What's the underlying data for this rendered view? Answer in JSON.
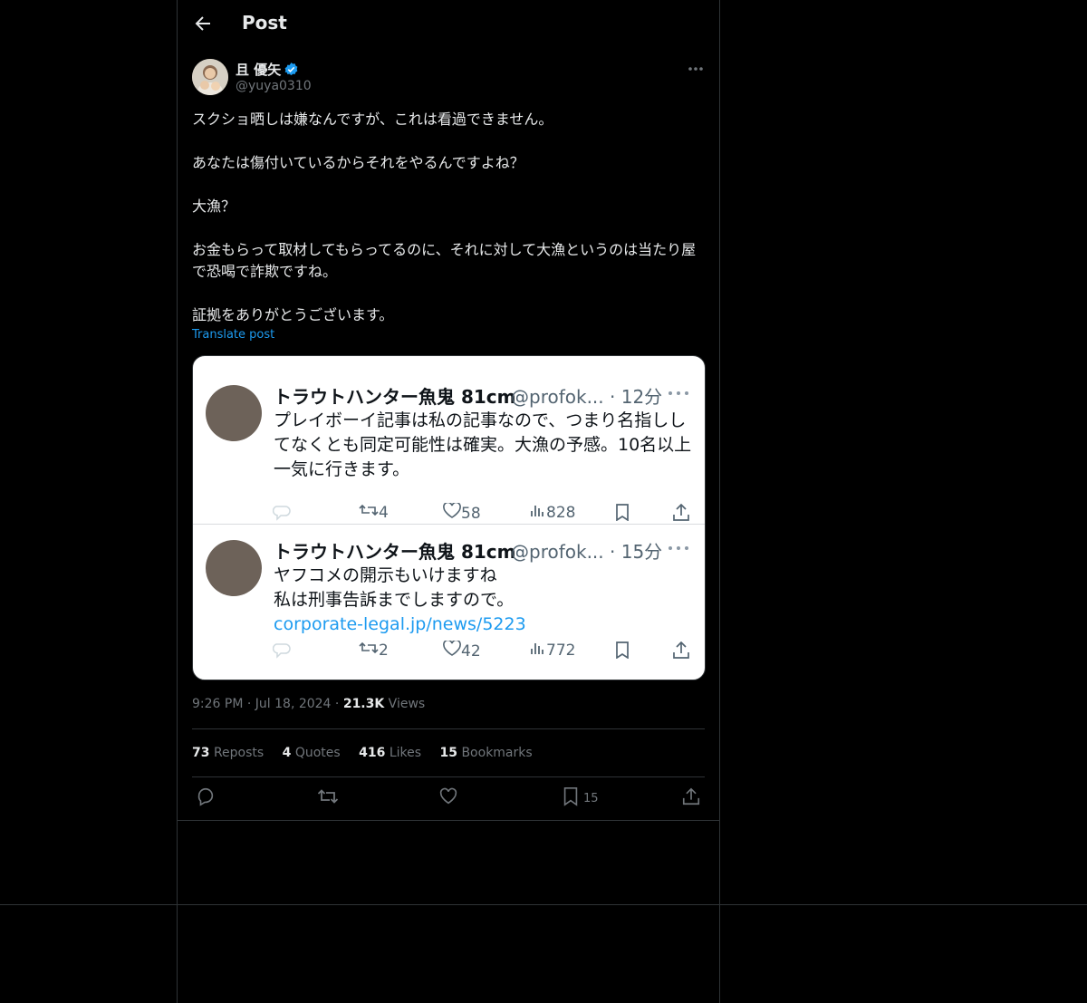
{
  "header": {
    "title": "Post"
  },
  "author": {
    "name": "且 優矢",
    "handle": "@yuya0310"
  },
  "post": {
    "lines": [
      "スクショ晒しは嫌なんですが、これは看過できません。",
      "",
      "あなたは傷付いているからそれをやるんですよね？",
      "",
      "大漁？",
      "",
      "お金もらって取材してもらってるのに、それに対して大漁というのは当たり屋で恐喝で詐欺ですね。",
      "",
      "証拠をありがとうございます。"
    ],
    "translate_label": "Translate post"
  },
  "screenshot": {
    "tweets": [
      {
        "name": "トラウトハンター魚鬼 81cm",
        "handle": "@profok... · 12分",
        "text": "プレイボーイ記事は私の記事なので、つまり名指ししてなくとも同定可能性は確実。大漁の予感。10名以上一気に行きます。",
        "link": "",
        "retweets": "4",
        "likes": "58",
        "views": "828"
      },
      {
        "name": "トラウトハンター魚鬼 81cm",
        "handle": "@profok... · 15分",
        "text": "ヤフコメの開示もいけますね\n私は刑事告訴までしますので。",
        "link": "corporate-legal.jp/news/5223",
        "retweets": "2",
        "likes": "42",
        "views": "772"
      }
    ]
  },
  "meta": {
    "time": "9:26 PM",
    "date": "Jul 18, 2024",
    "views_count": "21.3K",
    "views_label": "Views"
  },
  "stats": {
    "reposts": {
      "count": "73",
      "label": "Reposts"
    },
    "quotes": {
      "count": "4",
      "label": "Quotes"
    },
    "likes": {
      "count": "416",
      "label": "Likes"
    },
    "bookmarks": {
      "count": "15",
      "label": "Bookmarks"
    }
  },
  "actions": {
    "bookmark_count": "15"
  },
  "colors": {
    "background": "#000000",
    "accent": "#1d9bf0",
    "border": "#2f3336",
    "muted": "#71767b"
  }
}
